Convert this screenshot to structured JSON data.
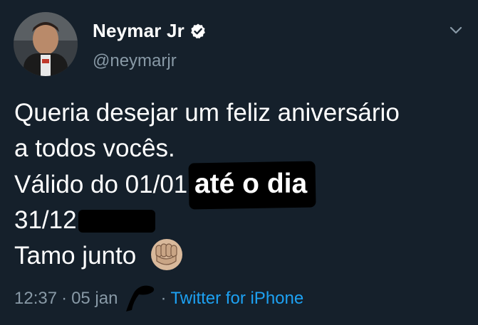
{
  "user": {
    "display_name": "Neymar Jr",
    "handle": "@neymarjr",
    "verified_icon": "verified-badge-icon",
    "avatar_icon": "profile-avatar"
  },
  "tweet": {
    "line1": "Queria desejar um feliz aniversário",
    "line2": "a todos vocês.",
    "line3_plain": "Válido do 01/01 ",
    "line3_overlay": "até o dia",
    "line4": "31/12",
    "line5": "Tamo junto",
    "emoji_icon": "raised-fist-icon"
  },
  "meta": {
    "time": "12:37",
    "separator": "·",
    "date": "05 jan",
    "source_separator": "·",
    "source": "Twitter for iPhone"
  },
  "colors": {
    "background": "#15202b",
    "text": "#ffffff",
    "secondary": "#8899a6",
    "link": "#1da1f2"
  }
}
